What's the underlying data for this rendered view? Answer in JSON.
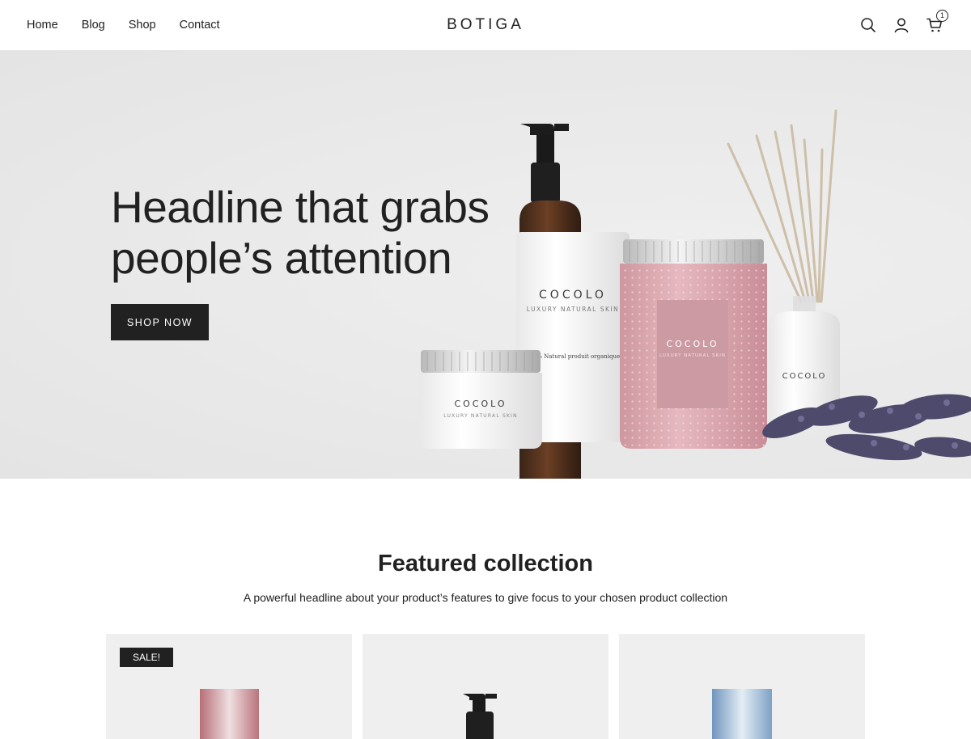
{
  "header": {
    "nav": [
      "Home",
      "Blog",
      "Shop",
      "Contact"
    ],
    "logo": "BOTIGA",
    "cart_count": "1",
    "icons": [
      "search-icon",
      "account-icon",
      "cart-icon"
    ]
  },
  "hero": {
    "headline": "Headline that grabs people’s attention",
    "button_label": "SHOP NOW",
    "product_labels": {
      "brand": "COCOLO",
      "tagline": "LUXURY NATURAL SKIN",
      "bottle_note": "100% Natural produit organique"
    }
  },
  "featured": {
    "title": "Featured collection",
    "subtitle": "A powerful headline about your product’s features to give focus to your chosen product collection",
    "cards": [
      {
        "badge": "SALE!"
      },
      {
        "badge": ""
      },
      {
        "badge": ""
      }
    ]
  },
  "colors": {
    "text": "#212121",
    "button_bg": "#212121",
    "hero_bg": "#e9e9e9",
    "card_bg": "#efefef",
    "jar_pink": "#d9a9b0"
  }
}
